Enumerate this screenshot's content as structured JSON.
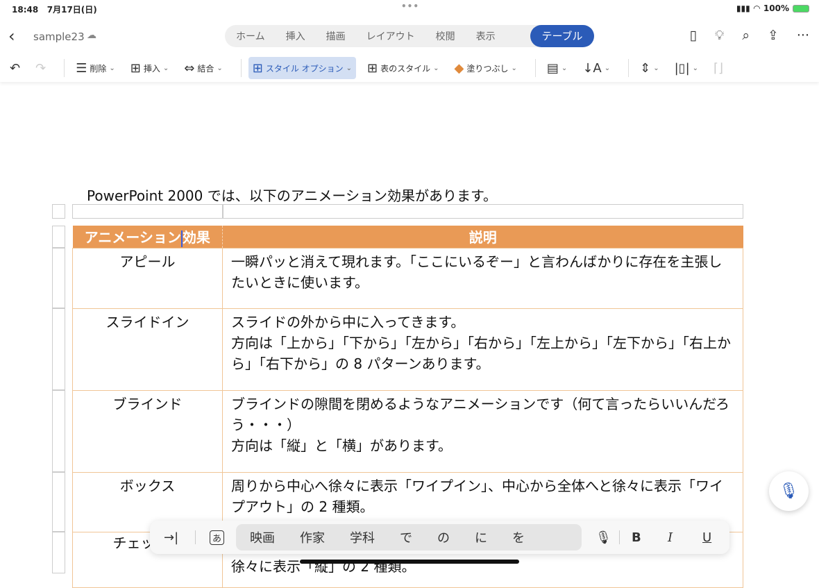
{
  "status": {
    "time": "18:48",
    "date": "7月17日(日)",
    "battery": "100%"
  },
  "header": {
    "filename": "sample23",
    "tabs": [
      "ホーム",
      "挿入",
      "描画",
      "レイアウト",
      "校閲",
      "表示"
    ],
    "active_tab": "テーブル"
  },
  "ribbon": {
    "delete": "削除",
    "insert": "挿入",
    "merge": "結合",
    "style_options": "スタイル オプション",
    "table_style": "表のスタイル",
    "shading": "塗りつぶし"
  },
  "doc": {
    "intro": "PowerPoint 2000 では、以下のアニメーション効果があります。",
    "headers": [
      "アニメーション効果",
      "説明"
    ],
    "rows": [
      {
        "name": "アピール",
        "desc": [
          "一瞬パッと消えて現れます。「ここにいるぞー」と言わんばかりに存在を主張したいときに使います。"
        ]
      },
      {
        "name": "スライドイン",
        "desc": [
          "スライドの外から中に入ってきます。",
          "方向は「上から」「下から」「左から」「右から」「左上から」「左下から」「右上から」「右下から」の 8 パターンあります。"
        ]
      },
      {
        "name": "ブラインド",
        "desc": [
          "ブラインドの隙間を閉めるようなアニメーションです（何て言ったらいいんだろう・・・）",
          "方向は「縦」と「横」があります。"
        ]
      },
      {
        "name": "ボックス",
        "desc": [
          "周りから中心へ徐々に表示「ワイプイン」、中心から全体へと徐々に表示「ワイプアウト」の 2 種類。"
        ]
      },
      {
        "name": "チェッカー",
        "desc": [
          "",
          "徐々に表示「縦」の 2 種類。"
        ]
      }
    ]
  },
  "keyboard": {
    "suggestions": [
      "映画",
      "作家",
      "学科",
      "で",
      "の",
      "に",
      "を"
    ],
    "bold": "B",
    "italic": "I",
    "underline": "U"
  },
  "colors": {
    "accent": "#2b5bb8",
    "header_fill": "#e99a56"
  }
}
